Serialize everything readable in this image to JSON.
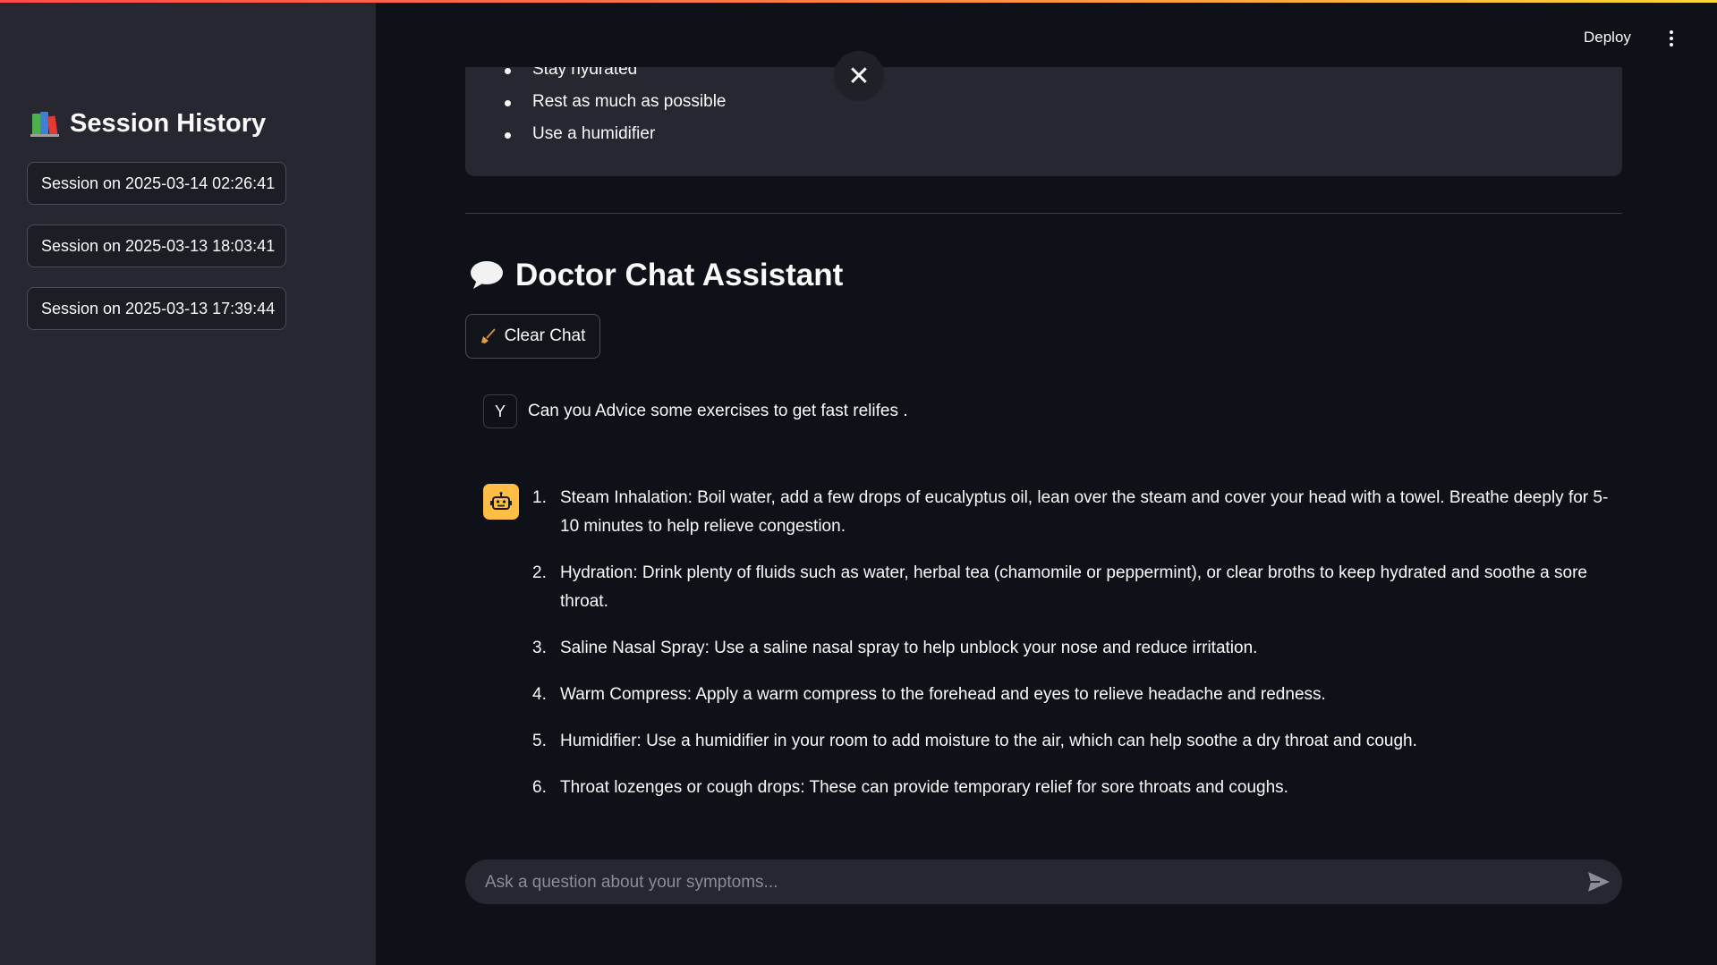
{
  "sidebar": {
    "title": "Session History",
    "title_icon": "books-icon",
    "sessions": [
      {
        "label": "Session on 2025-03-14 02:26:41"
      },
      {
        "label": "Session on 2025-03-13 18:03:41"
      },
      {
        "label": "Session on 2025-03-13 17:39:44"
      }
    ]
  },
  "header": {
    "deploy_label": "Deploy",
    "menu_icon": "vertical-dots-icon"
  },
  "advice": {
    "items": [
      "Stay hydrated",
      "Rest as much as possible",
      "Use a humidifier"
    ],
    "close_icon": "close-icon"
  },
  "chat": {
    "title": "Doctor Chat Assistant",
    "title_icon": "speech-bubble-icon",
    "clear_label": "Clear Chat",
    "clear_icon": "broom-icon",
    "user_avatar": "Y",
    "user_message": "Can you Advice some exercises to get fast relifes .",
    "bot_icon": "robot-icon",
    "bot_items": [
      {
        "num": "1.",
        "text": "Steam Inhalation: Boil water, add a few drops of eucalyptus oil, lean over the steam and cover your head with a towel. Breathe deeply for 5-10 minutes to help relieve congestion."
      },
      {
        "num": "2.",
        "text": "Hydration: Drink plenty of fluids such as water, herbal tea (chamomile or peppermint), or clear broths to keep hydrated and soothe a sore throat."
      },
      {
        "num": "3.",
        "text": "Saline Nasal Spray: Use a saline nasal spray to help unblock your nose and reduce irritation."
      },
      {
        "num": "4.",
        "text": "Warm Compress: Apply a warm compress to the forehead and eyes to relieve headache and redness."
      },
      {
        "num": "5.",
        "text": "Humidifier: Use a humidifier in your room to add moisture to the air, which can help soothe a dry throat and cough."
      },
      {
        "num": "6.",
        "text": "Throat lozenges or cough drops: These can provide temporary relief for sore throats and coughs."
      }
    ],
    "input_placeholder": "Ask a question about your symptoms...",
    "send_icon": "send-icon"
  },
  "colors": {
    "background": "#0e1117",
    "sidebar": "#262730",
    "bot_avatar": "#ffbd45",
    "text": "#fafafa"
  }
}
